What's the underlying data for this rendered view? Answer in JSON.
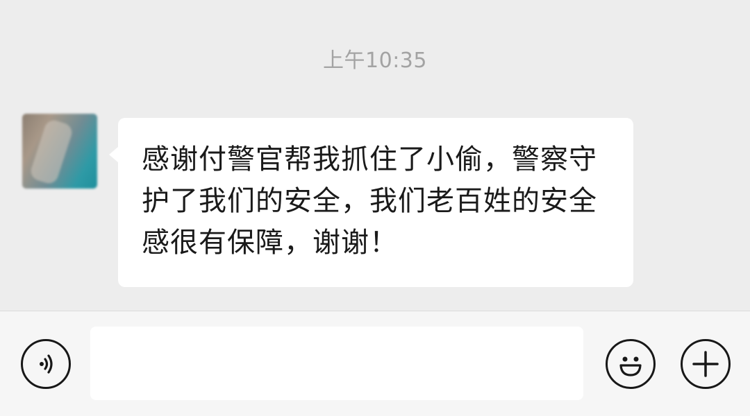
{
  "chat": {
    "timestamp": "上午10:35",
    "messages": [
      {
        "sender": "contact",
        "text": "感谢付警官帮我抓住了小偷，警察守护了我们的安全，我们老百姓的安全感很有保障，谢谢！"
      }
    ]
  },
  "input_bar": {
    "input_value": "",
    "icons": {
      "voice": "voice-icon",
      "emoji": "emoji-icon",
      "more": "plus-icon"
    }
  }
}
